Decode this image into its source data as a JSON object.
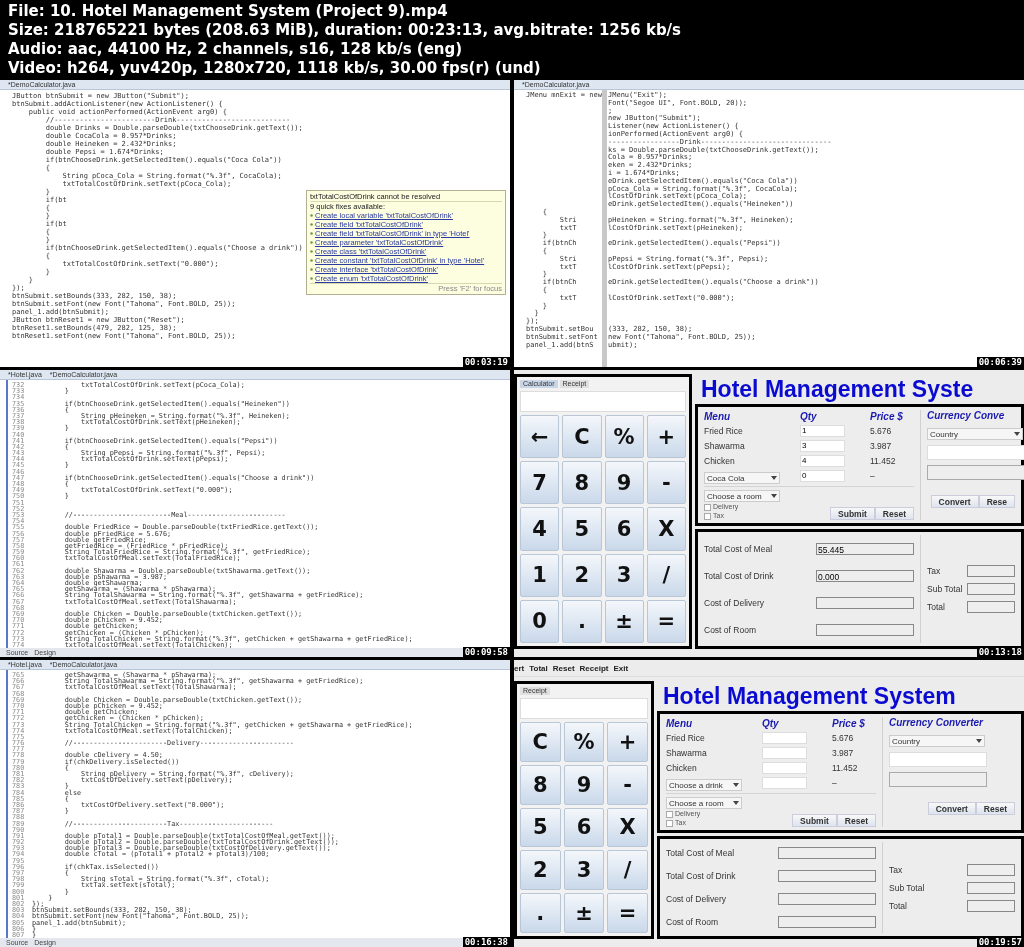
{
  "header": {
    "lines": [
      "File: 10. Hotel Management System (Project 9).mp4",
      "Size: 218765221 bytes (208.63 MiB), duration: 00:23:13, avg.bitrate: 1256 kb/s",
      "Audio: aac, 44100 Hz, 2 channels, s16, 128 kb/s (eng)",
      "Video: h264, yuv420p, 1280x720, 1118 kb/s, 30.00 fps(r) (und)"
    ]
  },
  "frames": [
    {
      "kind": "code",
      "timestamp": "00:03:19",
      "tabs": [
        "*DemoCalculator.java"
      ],
      "lines": [
        {
          "text": "JButton btnSubmit = new JButton(\"Submit\");"
        },
        {
          "text": "btnSubmit.addActionListener(new ActionListener() {"
        },
        {
          "text": "    public void actionPerformed(ActionEvent arg0) {"
        },
        {
          "text": "        //------------------------Drink---------------------------"
        },
        {
          "text": "        double Drinks = Double.parseDouble(txtChooseDrink.getText());"
        },
        {
          "text": "        double CocaCola = 0.957*Drinks;"
        },
        {
          "text": "        double Heineken = 2.432*Drinks;"
        },
        {
          "text": "        double Pepsi = 1.674*Drinks;"
        },
        {
          "text": "        if(btnChooseDrink.getSelectedItem().equals(\"Coca Cola\"))"
        },
        {
          "text": "        {"
        },
        {
          "text": "            String pCoca_Cola = String.format(\"%.3f\", CocaCola);"
        },
        {
          "text": "            txtTotalCostOfDrink.setText(pCoca_Cola);"
        },
        {
          "text": "        }"
        },
        {
          "text": "        if(bt"
        },
        {
          "text": "        {"
        },
        {
          "text": "        }"
        },
        {
          "text": "        if(bt"
        },
        {
          "text": "        {"
        },
        {
          "text": "        }"
        },
        {
          "text": "        if(btnChooseDrink.getSelectedItem().equals(\"Choose a drink\"))"
        },
        {
          "text": "        {"
        },
        {
          "text": "            txtTotalCostOfDrink.setText(\"0.000\");"
        },
        {
          "text": "        }"
        },
        {
          "text": "    }"
        },
        {
          "text": "});"
        },
        {
          "text": "btnSubmit.setBounds(333, 282, 150, 38);"
        },
        {
          "text": "btnSubmit.setFont(new Font(\"Tahoma\", Font.BOLD, 25));"
        },
        {
          "text": "panel_1.add(btnSubmit);"
        },
        {
          "text": "JButton btnReset1 = new JButton(\"Reset\");"
        },
        {
          "text": "btnReset1.setBounds(479, 282, 125, 38);"
        },
        {
          "text": "btnReset1.setFont(new Font(\"Tahoma\", Font.BOLD, 25));"
        }
      ],
      "popup": {
        "title": "txtTotalCostOfDrink cannot be resolved",
        "subtitle": "9 quick fixes available:",
        "fixes": [
          "Create local variable 'txtTotalCostOfDrink'",
          "Create field 'txtTotalCostOfDrink'",
          "Create field 'txtTotalCostOfDrink' in type 'Hotel'",
          "Create parameter 'txtTotalCostOfDrink'",
          "Create class 'txtTotalCostOfDrink'",
          "Create constant 'txtTotalCostOfDrink' in type 'Hotel'",
          "Create interface 'txtTotalCostOfDrink'",
          "Create enum 'txtTotalCostOfDrink'"
        ],
        "footer": "Press 'F2' for focus"
      }
    },
    {
      "kind": "split",
      "timestamp": "00:06:39",
      "tabs": [
        "*DemoCalculator.java"
      ],
      "lines": [
        {
          "left": "JMenu mnExit = new",
          "right": "JMenu(\"Exit\");"
        },
        {
          "right": "Font(\"Segoe UI\", Font.BOLD, 20));"
        },
        {
          "right": ";"
        },
        {
          "right": "new JButton(\"Submit\");"
        },
        {
          "right": "Listener(new ActionListener() {"
        },
        {
          "right": "ionPerformed(ActionEvent arg0) {"
        },
        {
          "right": "-----------------Drink-------------------------------"
        },
        {
          "right": "ks = Double.parseDouble(txtChooseDrink.getText());"
        },
        {
          "right": "Cola = 0.957*Drinks;"
        },
        {
          "right": "eken = 2.432*Drinks;"
        },
        {
          "right": "i = 1.674*Drinks;"
        },
        {
          "right": "eDrink.getSelectedItem().equals(\"Coca Cola\"))"
        },
        {
          "right": "pCoca_Cola = String.format(\"%.3f\", CocaCola);"
        },
        {
          "right": "lCostOfDrink.setText(pCoca_Cola);"
        },
        {
          "right": "eDrink.getSelectedItem().equals(\"Heineken\"))"
        },
        {
          "left": "    {"
        },
        {
          "left": "        Stri",
          "right": "pHeineken = String.format(\"%.3f\", Heineken);"
        },
        {
          "left": "        txtT",
          "right": "lCostOfDrink.setText(pHeineken);"
        },
        {
          "left": "    }"
        },
        {
          "left": "    if(btnCh",
          "right": "eDrink.getSelectedItem().equals(\"Pepsi\"))"
        },
        {
          "left": "    {"
        },
        {
          "left": "        Stri",
          "right": "pPepsi = String.format(\"%.3f\", Pepsi);"
        },
        {
          "left": "        txtT",
          "right": "lCostOfDrink.setText(pPepsi);"
        },
        {
          "left": "    }"
        },
        {
          "left": "    if(btnCh",
          "right": "eDrink.getSelectedItem().equals(\"Choose a drink\"))"
        },
        {
          "left": "    {"
        },
        {
          "left": "        txtT",
          "right": "lCostOfDrink.setText(\"0.000\");"
        },
        {
          "left": "    }"
        },
        {
          "left": "  }"
        },
        {
          "left": "});"
        },
        {
          "left": "btnSubmit.setBou",
          "right": "(333, 282, 150, 38);"
        },
        {
          "left": "btnSubmit.setFont",
          "right": "new Font(\"Tahoma\", Font.BOLD, 25));"
        },
        {
          "left": "panel_1.add(btnS",
          "right": "ubmit);"
        }
      ]
    },
    {
      "kind": "numbered",
      "timestamp": "00:09:58",
      "tabs": [
        "*Hotel.java",
        "*DemoCalculator.java"
      ],
      "bottom_tabs": [
        "Source",
        "Design"
      ],
      "lines": [
        {
          "number": "732",
          "text": "            txtTotalCostOfDrink.setText(pCoca_Cola);"
        },
        {
          "number": "733",
          "text": "        }"
        },
        {
          "number": "734"
        },
        {
          "number": "735",
          "text": "        if(btnChooseDrink.getSelectedItem().equals(\"Heineken\"))"
        },
        {
          "number": "736",
          "text": "        {"
        },
        {
          "number": "737",
          "text": "            String pHeineken = String.format(\"%.3f\", Heineken);"
        },
        {
          "number": "738",
          "text": "            txtTotalCostOfDrink.setText(pHeineken);"
        },
        {
          "number": "739",
          "text": "        }"
        },
        {
          "number": "740"
        },
        {
          "number": "741",
          "text": "        if(btnChooseDrink.getSelectedItem().equals(\"Pepsi\"))"
        },
        {
          "number": "742",
          "text": "        {"
        },
        {
          "number": "743",
          "text": "            String pPepsi = String.format(\"%.3f\", Pepsi);"
        },
        {
          "number": "744",
          "text": "            txtTotalCostOfDrink.setText(pPepsi);"
        },
        {
          "number": "745",
          "text": "        }"
        },
        {
          "number": "746"
        },
        {
          "number": "747",
          "text": "        if(btnChooseDrink.getSelectedItem().equals(\"Choose a drink\"))"
        },
        {
          "number": "748",
          "text": "        {"
        },
        {
          "number": "749",
          "text": "            txtTotalCostOfDrink.setText(\"0.000\");"
        },
        {
          "number": "750",
          "text": "        }"
        },
        {
          "number": "751"
        },
        {
          "number": "752"
        },
        {
          "number": "753",
          "text": "        //------------------------Meal------------------------"
        },
        {
          "number": "754"
        },
        {
          "number": "755",
          "text": "        double FriedRice = Double.parseDouble(txtFriedRice.getText());"
        },
        {
          "number": "756",
          "text": "        double pFriedRice = 5.676;"
        },
        {
          "number": "757",
          "text": "        double getFriedRice;"
        },
        {
          "number": "758",
          "text": "        getFriedRice = (FriedRice * pFriedRice);"
        },
        {
          "number": "759",
          "text": "        String TotalFriedRice = String.format(\"%.3f\", getFriedRice);"
        },
        {
          "number": "760",
          "text": "        txtTotalCostOfMeal.setText(TotalFriedRice);"
        },
        {
          "number": "761"
        },
        {
          "number": "762",
          "text": "        double Shawarma = Double.parseDouble(txtShawarma.getText());"
        },
        {
          "number": "763",
          "text": "        double pShawarma = 3.987;"
        },
        {
          "number": "764",
          "text": "        double getShawarma;"
        },
        {
          "number": "765",
          "text": "        getShawarma = (Shawarma * pShawarma);"
        },
        {
          "number": "766",
          "text": "        String TotalShawarma = String.format(\"%.3f\", getShawarma + getFriedRice);"
        },
        {
          "number": "767",
          "text": "        txtTotalCostOfMeal.setText(TotalShawarma);"
        },
        {
          "number": "768"
        },
        {
          "number": "769",
          "text": "        double Chicken = Double.parseDouble(txtChicken.getText());"
        },
        {
          "number": "770",
          "text": "        double pChicken = 9.452;"
        },
        {
          "number": "771",
          "text": "        double getChicken;"
        },
        {
          "number": "772",
          "text": "        getChicken = (Chicken * pChicken);"
        },
        {
          "number": "773",
          "text": "        String TotalChicken = String.format(\"%.3f\", getChicken + getShawarma + getFriedRice);"
        },
        {
          "number": "774",
          "text": "        txtTotalCostOfMeal.setText(TotalChicken);"
        }
      ]
    },
    {
      "kind": "app",
      "timestamp": "00:13:18",
      "calc": {
        "tabs": [
          {
            "label": "Calculator",
            "selected": true
          },
          {
            "label": "Receipt",
            "selected": false
          }
        ],
        "keys": [
          "←",
          "C",
          "%",
          "+",
          "7",
          "8",
          "9",
          "-",
          "4",
          "5",
          "6",
          "X",
          "1",
          "2",
          "3",
          "/",
          "0",
          ".",
          "±",
          "="
        ]
      },
      "title": "Hotel Management Syste",
      "order": {
        "headers": [
          "Menu",
          "Qty",
          "Price $"
        ],
        "items": [
          {
            "name": "Fried Rice",
            "qty": "1",
            "price": "5.676"
          },
          {
            "name": "Shawarma",
            "qty": "3",
            "price": "3.987"
          },
          {
            "name": "Chicken",
            "qty": "4",
            "price": "11.452"
          }
        ],
        "drink": {
          "choice": "Coca Cola",
          "qty": "0",
          "price": "–"
        },
        "room": "Choose a room",
        "checks": [
          {
            "label": "Delivery",
            "checked": false
          },
          {
            "label": "Tax",
            "checked": false
          }
        ],
        "buttons": [
          "Submit",
          "Reset"
        ]
      },
      "currency": {
        "header": "Currency Conve",
        "country": "Country",
        "buttons": [
          "Convert",
          "Rese"
        ]
      },
      "totals": {
        "left": [
          {
            "label": "Total Cost of Meal",
            "value": "55.445"
          },
          {
            "label": "Total Cost of Drink",
            "value": "0.000"
          },
          {
            "label": "Cost of Delivery"
          },
          {
            "label": "Cost of Room"
          }
        ],
        "right": [
          "Tax",
          "Sub Total",
          "Total"
        ]
      }
    },
    {
      "kind": "numbered",
      "timestamp": "00:16:38",
      "tabs": [
        "*Hotel.java",
        "*DemoCalculator.java"
      ],
      "bottom_tabs": [
        "Source",
        "Design"
      ],
      "lines": [
        {
          "number": "765",
          "text": "        getShawarma = (Shawarma * pShawarma);"
        },
        {
          "number": "766",
          "text": "        String TotalShawarma = String.format(\"%.3f\", getShawarma + getFriedRice);"
        },
        {
          "number": "767",
          "text": "        txtTotalCostOfMeal.setText(TotalShawarma);"
        },
        {
          "number": "768"
        },
        {
          "number": "769",
          "text": "        double Chicken = Double.parseDouble(txtChicken.getText());"
        },
        {
          "number": "770",
          "text": "        double pChicken = 9.452;"
        },
        {
          "number": "771",
          "text": "        double getChicken;"
        },
        {
          "number": "772",
          "text": "        getChicken = (Chicken * pChicken);"
        },
        {
          "number": "773",
          "text": "        String TotalChicken = String.format(\"%.3f\", getChicken + getShawarma + getFriedRice);"
        },
        {
          "number": "774",
          "text": "        txtTotalCostOfMeal.setText(TotalChicken);"
        },
        {
          "number": "775"
        },
        {
          "number": "776",
          "text": "        //-----------------------Delivery-----------------------"
        },
        {
          "number": "777"
        },
        {
          "number": "778",
          "text": "        double cDelivery = 4.50;"
        },
        {
          "number": "779",
          "text": "        if(chkDelivery.isSelected())"
        },
        {
          "number": "780",
          "text": "        {"
        },
        {
          "number": "781",
          "text": "            String pDelivery = String.format(\"%.3f\", cDelivery);"
        },
        {
          "number": "782",
          "text": "            txtCostOfDelivery.setText(pDelivery);"
        },
        {
          "number": "783",
          "text": "        }"
        },
        {
          "number": "784",
          "text": "        else"
        },
        {
          "number": "785",
          "text": "        {"
        },
        {
          "number": "786",
          "text": "            txtCostOfDelivery.setText(\"0.000\");"
        },
        {
          "number": "787",
          "text": "        }"
        },
        {
          "number": "788"
        },
        {
          "number": "789",
          "text": "        //-----------------------Tax-----------------------"
        },
        {
          "number": "790"
        },
        {
          "number": "791",
          "text": "        double pTotal1 = Double.parseDouble(txtTotalCostOfMeal.getText());"
        },
        {
          "number": "792",
          "text": "        double pTotal2 = Double.parseDouble(txtTotalCostOfDrink.getText());"
        },
        {
          "number": "793",
          "text": "        double pTotal3 = Double.parseDouble(txtCostOfDelivery.getText());"
        },
        {
          "number": "794",
          "text": "        double cTotal = (pTotal1 + pTotal2 + pTotal3)/100;"
        },
        {
          "number": "795"
        },
        {
          "number": "796",
          "text": "        if(chkTax.isSelected())"
        },
        {
          "number": "797",
          "text": "        {"
        },
        {
          "number": "798",
          "text": "            String sTotal = String.format(\"%.3f\", cTotal);"
        },
        {
          "number": "799",
          "text": "            txtTax.setText(sTotal);"
        },
        {
          "number": "800",
          "text": "        }"
        },
        {
          "number": "801",
          "text": "    }"
        },
        {
          "number": "802",
          "text": "});"
        },
        {
          "number": "803",
          "text": "btnSubmit.setBounds(333, 282, 150, 38);"
        },
        {
          "number": "804",
          "text": "btnSubmit.setFont(new Font(\"Tahoma\", Font.BOLD, 25));"
        },
        {
          "number": "805",
          "text": "panel_1.add(btnSubmit);"
        },
        {
          "number": "806",
          "text": "}"
        },
        {
          "number": "807",
          "text": "}"
        }
      ]
    },
    {
      "kind": "app",
      "timestamp": "00:19:57",
      "menu_bar": [
        "ert",
        "Total",
        "Reset",
        "Receipt",
        "Exit"
      ],
      "calc": {
        "tabs": [
          {
            "label": "Receipt",
            "selected": false
          }
        ],
        "keys": [
          "C",
          "%",
          "+",
          "8",
          "9",
          "-",
          "5",
          "6",
          "X",
          "2",
          "3",
          "/",
          ".",
          "±",
          "="
        ]
      },
      "title": "Hotel Management System",
      "order": {
        "headers": [
          "Menu",
          "Qty",
          "Price $"
        ],
        "items": [
          {
            "name": "Fried Rice",
            "price": "5.676"
          },
          {
            "name": "Shawarma",
            "price": "3.987"
          },
          {
            "name": "Chicken",
            "price": "11.452"
          }
        ],
        "drink": {
          "choice": "Choose a drink",
          "price": "–"
        },
        "room": "Choose a room",
        "checks": [
          {
            "label": "Delivery",
            "checked": false
          },
          {
            "label": "Tax",
            "checked": false
          }
        ],
        "buttons": [
          "Submit",
          "Reset"
        ]
      },
      "currency": {
        "header": "Currency Converter",
        "country": "Country",
        "buttons": [
          "Convert",
          "Reset"
        ]
      },
      "totals": {
        "left": [
          {
            "label": "Total Cost of Meal"
          },
          {
            "label": "Total Cost of Drink"
          },
          {
            "label": "Cost of Delivery"
          },
          {
            "label": "Cost of Room"
          }
        ],
        "right": [
          "Tax",
          "Sub Total",
          "Total"
        ]
      }
    }
  ]
}
